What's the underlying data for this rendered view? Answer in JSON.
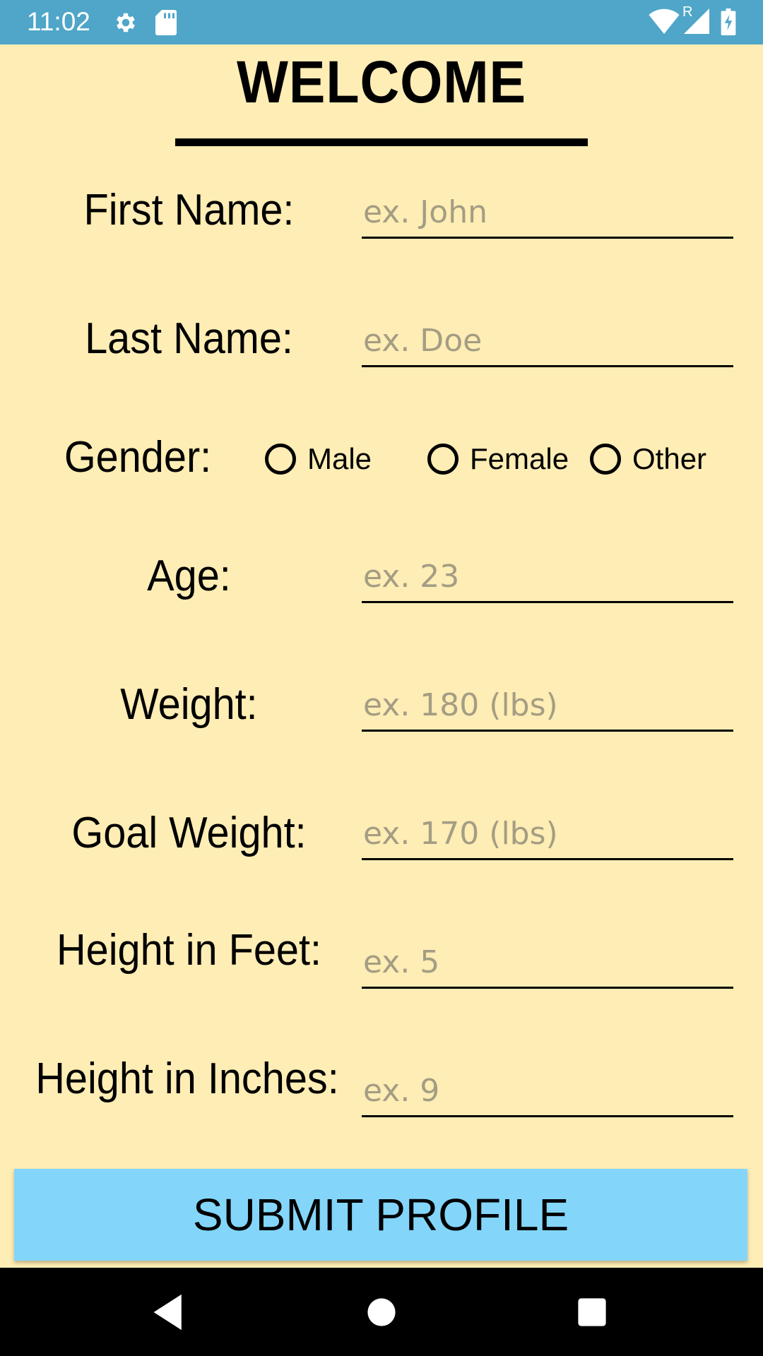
{
  "status_bar": {
    "time": "11:02",
    "icons": [
      "settings-gear-icon",
      "sd-card-icon",
      "wifi-icon",
      "roaming-indicator",
      "cell-signal-icon",
      "battery-charging-icon"
    ],
    "roaming": "R"
  },
  "form": {
    "title": "WELCOME",
    "fields": {
      "first_name": {
        "label": "First Name:",
        "placeholder": "ex. John",
        "value": ""
      },
      "last_name": {
        "label": "Last Name:",
        "placeholder": "ex. Doe",
        "value": ""
      },
      "age": {
        "label": "Age:",
        "placeholder": "ex. 23",
        "value": ""
      },
      "weight": {
        "label": "Weight:",
        "placeholder": "ex. 180 (lbs)",
        "value": ""
      },
      "goal_weight": {
        "label": "Goal Weight:",
        "placeholder": "ex. 170 (lbs)",
        "value": ""
      },
      "height_feet": {
        "label": "Height in Feet:",
        "placeholder": "ex. 5",
        "value": ""
      },
      "height_inches": {
        "label": "Height in Inches:",
        "placeholder": "ex. 9",
        "value": ""
      }
    },
    "gender": {
      "label": "Gender:",
      "options": [
        "Male",
        "Female",
        "Other"
      ],
      "selected": null
    },
    "submit_label": "SUBMIT PROFILE"
  },
  "colors": {
    "background": "#FEEDB4",
    "status_bar": "#4FA6C8",
    "submit_button": "#83D6FA",
    "placeholder_text": "#A49D84"
  },
  "nav_bar": {
    "buttons": [
      "back-icon",
      "home-icon",
      "recents-icon"
    ]
  }
}
